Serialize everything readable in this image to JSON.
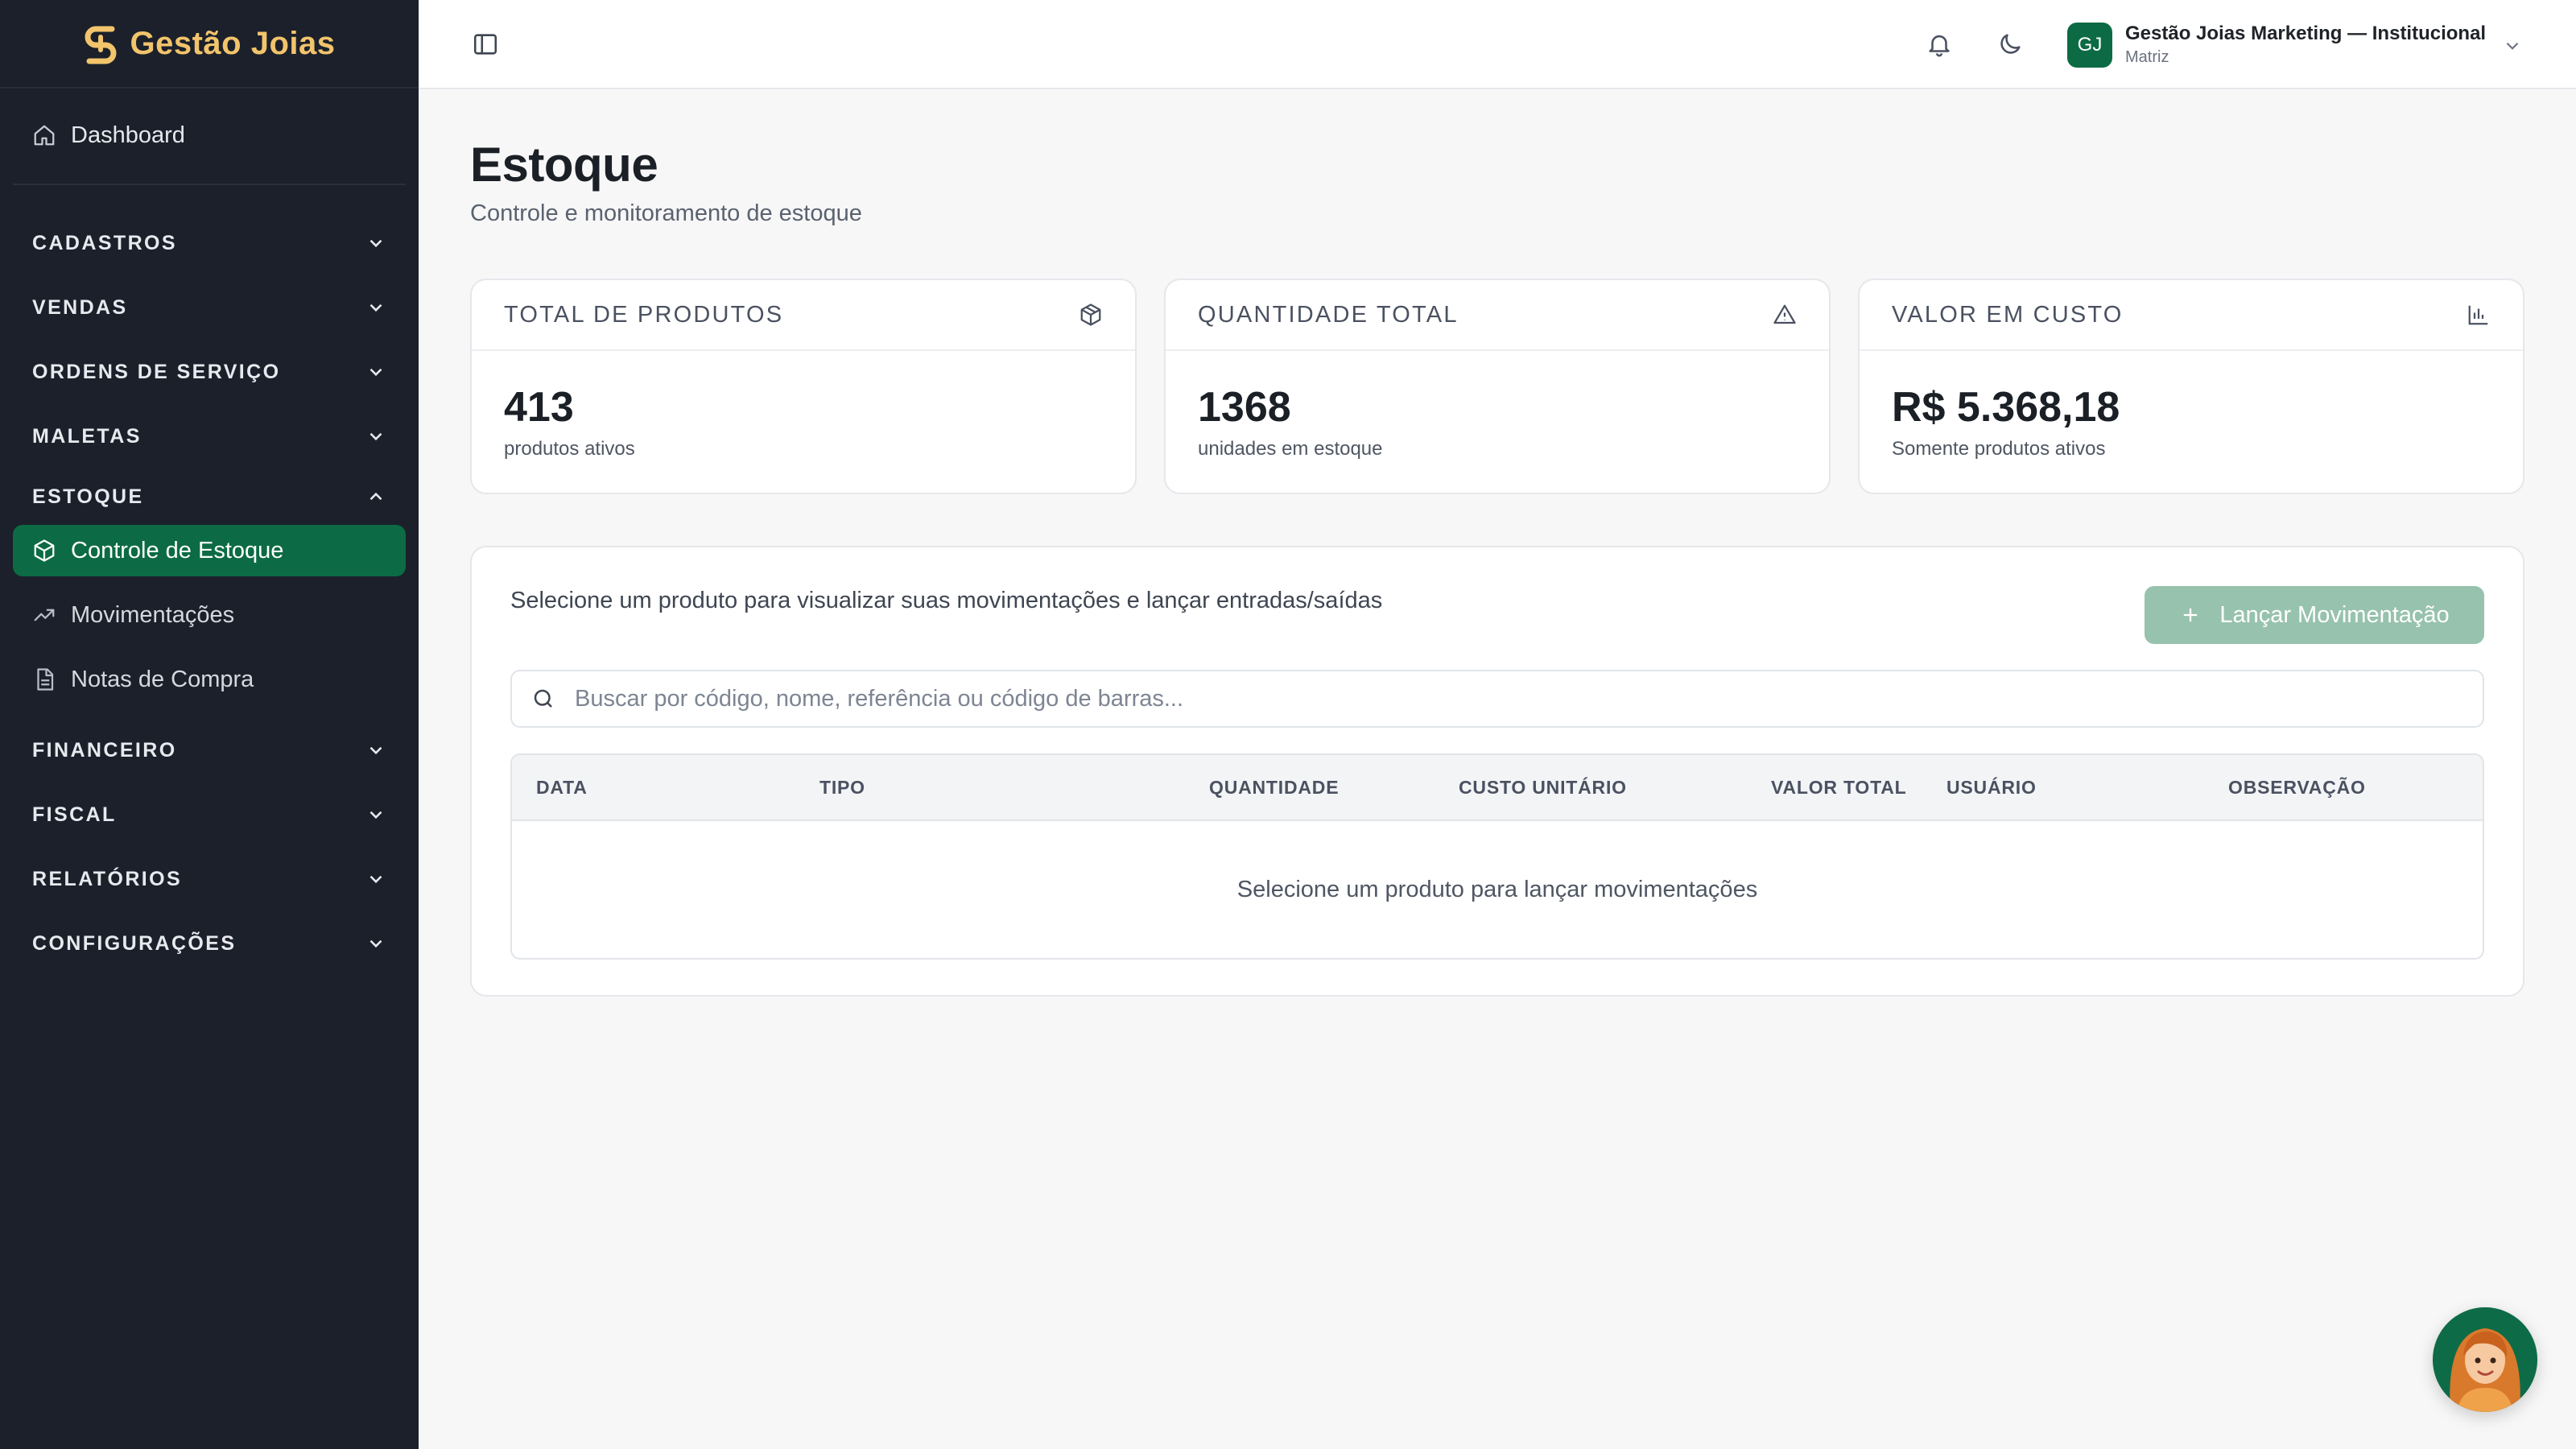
{
  "brand": {
    "name": "Gestão Joias",
    "logo_icon": "brand-g-icon",
    "color": "#f2c46b"
  },
  "sidebar": {
    "dashboard": {
      "label": "Dashboard",
      "icon": "home-icon"
    },
    "sections": [
      {
        "label": "CADASTROS",
        "expanded": false
      },
      {
        "label": "VENDAS",
        "expanded": false
      },
      {
        "label": "ORDENS DE SERVIÇO",
        "expanded": false
      },
      {
        "label": "MALETAS",
        "expanded": false
      },
      {
        "label": "ESTOQUE",
        "expanded": true
      },
      {
        "label": "FINANCEIRO",
        "expanded": false
      },
      {
        "label": "FISCAL",
        "expanded": false
      },
      {
        "label": "RELATÓRIOS",
        "expanded": false
      },
      {
        "label": "CONFIGURAÇÕES",
        "expanded": false
      }
    ],
    "estoque_items": [
      {
        "label": "Controle de Estoque",
        "icon": "box-icon",
        "active": true
      },
      {
        "label": "Movimentações",
        "icon": "trending-up-icon",
        "active": false
      },
      {
        "label": "Notas de Compra",
        "icon": "document-icon",
        "active": false
      }
    ],
    "active_color": "#0c6b44"
  },
  "topbar": {
    "avatar_initials": "GJ",
    "org_name": "Gestão Joias Marketing — Institucional",
    "org_branch": "Matriz"
  },
  "page": {
    "title": "Estoque",
    "subtitle": "Controle e monitoramento de estoque"
  },
  "stats": [
    {
      "label": "TOTAL DE PRODUTOS",
      "value": "413",
      "caption": "produtos ativos",
      "icon": "package-icon"
    },
    {
      "label": "QUANTIDADE TOTAL",
      "value": "1368",
      "caption": "unidades em estoque",
      "icon": "warning-icon"
    },
    {
      "label": "VALOR EM CUSTO",
      "value": "R$ 5.368,18",
      "caption": "Somente produtos ativos",
      "icon": "bar-chart-icon"
    }
  ],
  "movements": {
    "hint": "Selecione um produto para visualizar suas movimentações e lançar entradas/saídas",
    "launch_button": "Lançar Movimentação",
    "search_placeholder": "Buscar por código, nome, referência ou código de barras...",
    "columns": [
      "DATA",
      "TIPO",
      "QUANTIDADE",
      "CUSTO UNITÁRIO",
      "VALOR TOTAL",
      "USUÁRIO",
      "OBSERVAÇÃO"
    ],
    "empty_message": "Selecione um produto para lançar movimentações"
  }
}
